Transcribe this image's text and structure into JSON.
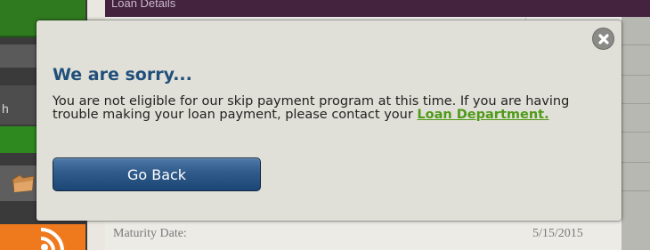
{
  "background": {
    "header_title": "Loan Details",
    "sidebar_letter": "h",
    "maturity_label": "Maturity Date:",
    "maturity_value": "5/15/2015"
  },
  "modal": {
    "title": "We are sorry...",
    "message_prefix": "You are not eligible for our skip payment program at this time. If you are having trouble making your loan payment, please contact your ",
    "link_text": "Loan Department.",
    "button_label": "Go Back",
    "close_icon": "close-icon"
  },
  "colors": {
    "title": "#1f4f7a",
    "link": "#4f9a18",
    "button": "#2f5a8a",
    "modal_bg": "#e1e0d8"
  }
}
